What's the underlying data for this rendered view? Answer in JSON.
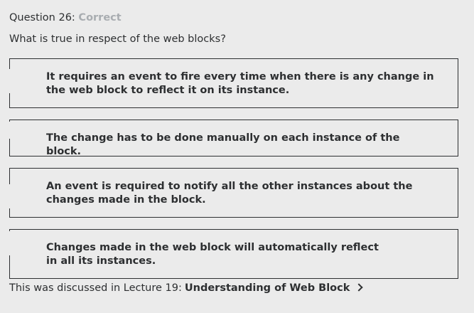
{
  "question": {
    "label": "Question 26:",
    "status": "Correct",
    "prompt": "What is true in respect of the web blocks?"
  },
  "answers": [
    {
      "text": "It requires an event to fire every time when there is any change in the web block to reflect it on its instance."
    },
    {
      "text": "The change has to be done manually on each instance of the block."
    },
    {
      "text": "An event is required to notify all the other instances about the changes made in the block."
    },
    {
      "text": "Changes made in the web block will automatically reflect in all its instances."
    }
  ],
  "footer": {
    "prefix": "This was discussed in Lecture 19:",
    "link": "Understanding of Web Block",
    "link_icon": "chevron-right-icon"
  },
  "colors": {
    "background": "#ebebeb",
    "text": "#2d2f31",
    "status": "#a9adb1"
  }
}
